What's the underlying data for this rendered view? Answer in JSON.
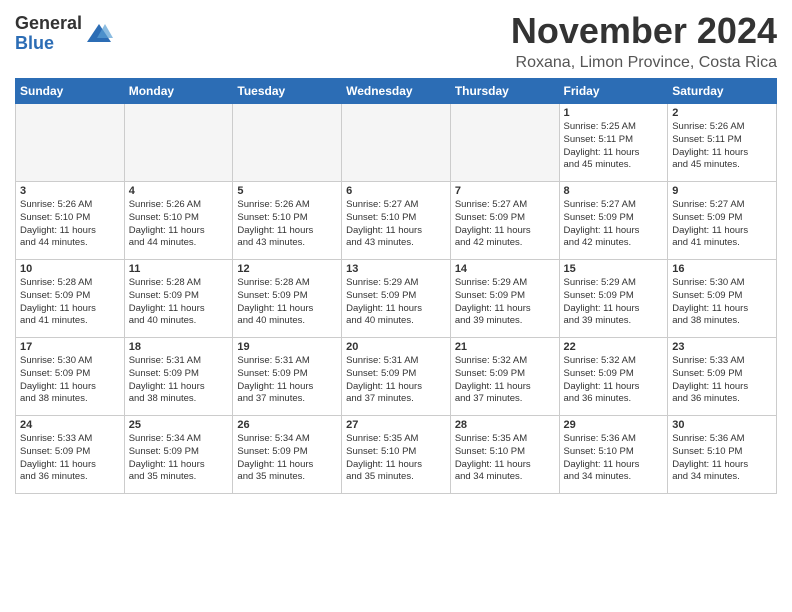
{
  "logo": {
    "general": "General",
    "blue": "Blue"
  },
  "title": "November 2024",
  "location": "Roxana, Limon Province, Costa Rica",
  "weekdays": [
    "Sunday",
    "Monday",
    "Tuesday",
    "Wednesday",
    "Thursday",
    "Friday",
    "Saturday"
  ],
  "weeks": [
    [
      {
        "day": "",
        "info": ""
      },
      {
        "day": "",
        "info": ""
      },
      {
        "day": "",
        "info": ""
      },
      {
        "day": "",
        "info": ""
      },
      {
        "day": "",
        "info": ""
      },
      {
        "day": "1",
        "info": "Sunrise: 5:25 AM\nSunset: 5:11 PM\nDaylight: 11 hours\nand 45 minutes."
      },
      {
        "day": "2",
        "info": "Sunrise: 5:26 AM\nSunset: 5:11 PM\nDaylight: 11 hours\nand 45 minutes."
      }
    ],
    [
      {
        "day": "3",
        "info": "Sunrise: 5:26 AM\nSunset: 5:10 PM\nDaylight: 11 hours\nand 44 minutes."
      },
      {
        "day": "4",
        "info": "Sunrise: 5:26 AM\nSunset: 5:10 PM\nDaylight: 11 hours\nand 44 minutes."
      },
      {
        "day": "5",
        "info": "Sunrise: 5:26 AM\nSunset: 5:10 PM\nDaylight: 11 hours\nand 43 minutes."
      },
      {
        "day": "6",
        "info": "Sunrise: 5:27 AM\nSunset: 5:10 PM\nDaylight: 11 hours\nand 43 minutes."
      },
      {
        "day": "7",
        "info": "Sunrise: 5:27 AM\nSunset: 5:09 PM\nDaylight: 11 hours\nand 42 minutes."
      },
      {
        "day": "8",
        "info": "Sunrise: 5:27 AM\nSunset: 5:09 PM\nDaylight: 11 hours\nand 42 minutes."
      },
      {
        "day": "9",
        "info": "Sunrise: 5:27 AM\nSunset: 5:09 PM\nDaylight: 11 hours\nand 41 minutes."
      }
    ],
    [
      {
        "day": "10",
        "info": "Sunrise: 5:28 AM\nSunset: 5:09 PM\nDaylight: 11 hours\nand 41 minutes."
      },
      {
        "day": "11",
        "info": "Sunrise: 5:28 AM\nSunset: 5:09 PM\nDaylight: 11 hours\nand 40 minutes."
      },
      {
        "day": "12",
        "info": "Sunrise: 5:28 AM\nSunset: 5:09 PM\nDaylight: 11 hours\nand 40 minutes."
      },
      {
        "day": "13",
        "info": "Sunrise: 5:29 AM\nSunset: 5:09 PM\nDaylight: 11 hours\nand 40 minutes."
      },
      {
        "day": "14",
        "info": "Sunrise: 5:29 AM\nSunset: 5:09 PM\nDaylight: 11 hours\nand 39 minutes."
      },
      {
        "day": "15",
        "info": "Sunrise: 5:29 AM\nSunset: 5:09 PM\nDaylight: 11 hours\nand 39 minutes."
      },
      {
        "day": "16",
        "info": "Sunrise: 5:30 AM\nSunset: 5:09 PM\nDaylight: 11 hours\nand 38 minutes."
      }
    ],
    [
      {
        "day": "17",
        "info": "Sunrise: 5:30 AM\nSunset: 5:09 PM\nDaylight: 11 hours\nand 38 minutes."
      },
      {
        "day": "18",
        "info": "Sunrise: 5:31 AM\nSunset: 5:09 PM\nDaylight: 11 hours\nand 38 minutes."
      },
      {
        "day": "19",
        "info": "Sunrise: 5:31 AM\nSunset: 5:09 PM\nDaylight: 11 hours\nand 37 minutes."
      },
      {
        "day": "20",
        "info": "Sunrise: 5:31 AM\nSunset: 5:09 PM\nDaylight: 11 hours\nand 37 minutes."
      },
      {
        "day": "21",
        "info": "Sunrise: 5:32 AM\nSunset: 5:09 PM\nDaylight: 11 hours\nand 37 minutes."
      },
      {
        "day": "22",
        "info": "Sunrise: 5:32 AM\nSunset: 5:09 PM\nDaylight: 11 hours\nand 36 minutes."
      },
      {
        "day": "23",
        "info": "Sunrise: 5:33 AM\nSunset: 5:09 PM\nDaylight: 11 hours\nand 36 minutes."
      }
    ],
    [
      {
        "day": "24",
        "info": "Sunrise: 5:33 AM\nSunset: 5:09 PM\nDaylight: 11 hours\nand 36 minutes."
      },
      {
        "day": "25",
        "info": "Sunrise: 5:34 AM\nSunset: 5:09 PM\nDaylight: 11 hours\nand 35 minutes."
      },
      {
        "day": "26",
        "info": "Sunrise: 5:34 AM\nSunset: 5:09 PM\nDaylight: 11 hours\nand 35 minutes."
      },
      {
        "day": "27",
        "info": "Sunrise: 5:35 AM\nSunset: 5:10 PM\nDaylight: 11 hours\nand 35 minutes."
      },
      {
        "day": "28",
        "info": "Sunrise: 5:35 AM\nSunset: 5:10 PM\nDaylight: 11 hours\nand 34 minutes."
      },
      {
        "day": "29",
        "info": "Sunrise: 5:36 AM\nSunset: 5:10 PM\nDaylight: 11 hours\nand 34 minutes."
      },
      {
        "day": "30",
        "info": "Sunrise: 5:36 AM\nSunset: 5:10 PM\nDaylight: 11 hours\nand 34 minutes."
      }
    ]
  ]
}
